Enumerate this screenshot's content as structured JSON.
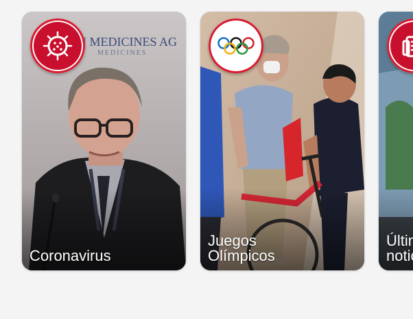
{
  "stories": [
    {
      "label": "Coronavirus",
      "icon": "virus-icon",
      "accent": "#c8102e"
    },
    {
      "label": "Juegos Olímpicos",
      "icon": "olympic-rings-icon",
      "accent": "#c8102e"
    },
    {
      "label": "Últimas noticias",
      "icon": "newspaper-icon",
      "accent": "#c8102e"
    }
  ],
  "card0": {
    "backdrop_line1": "IN MEDICINES AG",
    "backdrop_line2": "MEDICINES"
  },
  "colors": {
    "brand_red": "#c8102e",
    "page_bg": "#f4f4f5"
  }
}
